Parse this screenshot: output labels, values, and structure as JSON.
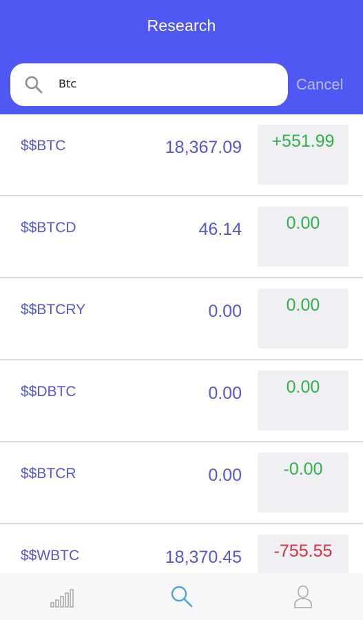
{
  "header": {
    "title": "Research"
  },
  "search": {
    "value": "Btc",
    "cancel_label": "Cancel"
  },
  "results": [
    {
      "symbol": "$$BTC",
      "price": "18,367.09",
      "change": "+551.99",
      "change_color": "#2fb24a"
    },
    {
      "symbol": "$$BTCD",
      "price": "46.14",
      "change": "0.00",
      "change_color": "#2fb24a"
    },
    {
      "symbol": "$$BTCRY",
      "price": "0.00",
      "change": "0.00",
      "change_color": "#2fb24a"
    },
    {
      "symbol": "$$DBTC",
      "price": "0.00",
      "change": "0.00",
      "change_color": "#2fb24a"
    },
    {
      "symbol": "$$BTCR",
      "price": "0.00",
      "change": "-0.00",
      "change_color": "#2fb24a"
    },
    {
      "symbol": "$$WBTC",
      "price": "18,370.45",
      "change": "-755.55",
      "change_color": "#d9313c"
    }
  ],
  "tabbar": {
    "tabs": [
      {
        "icon": "bar-chart-icon",
        "active": false
      },
      {
        "icon": "search-icon",
        "active": true
      },
      {
        "icon": "profile-icon",
        "active": false
      }
    ],
    "active_color": "#4aa3d8",
    "inactive_color": "#a5a5a5"
  },
  "colors": {
    "accent": "#5058f3",
    "symbol_text": "#5257cc",
    "positive": "#2fb24a",
    "negative": "#d9313c"
  }
}
